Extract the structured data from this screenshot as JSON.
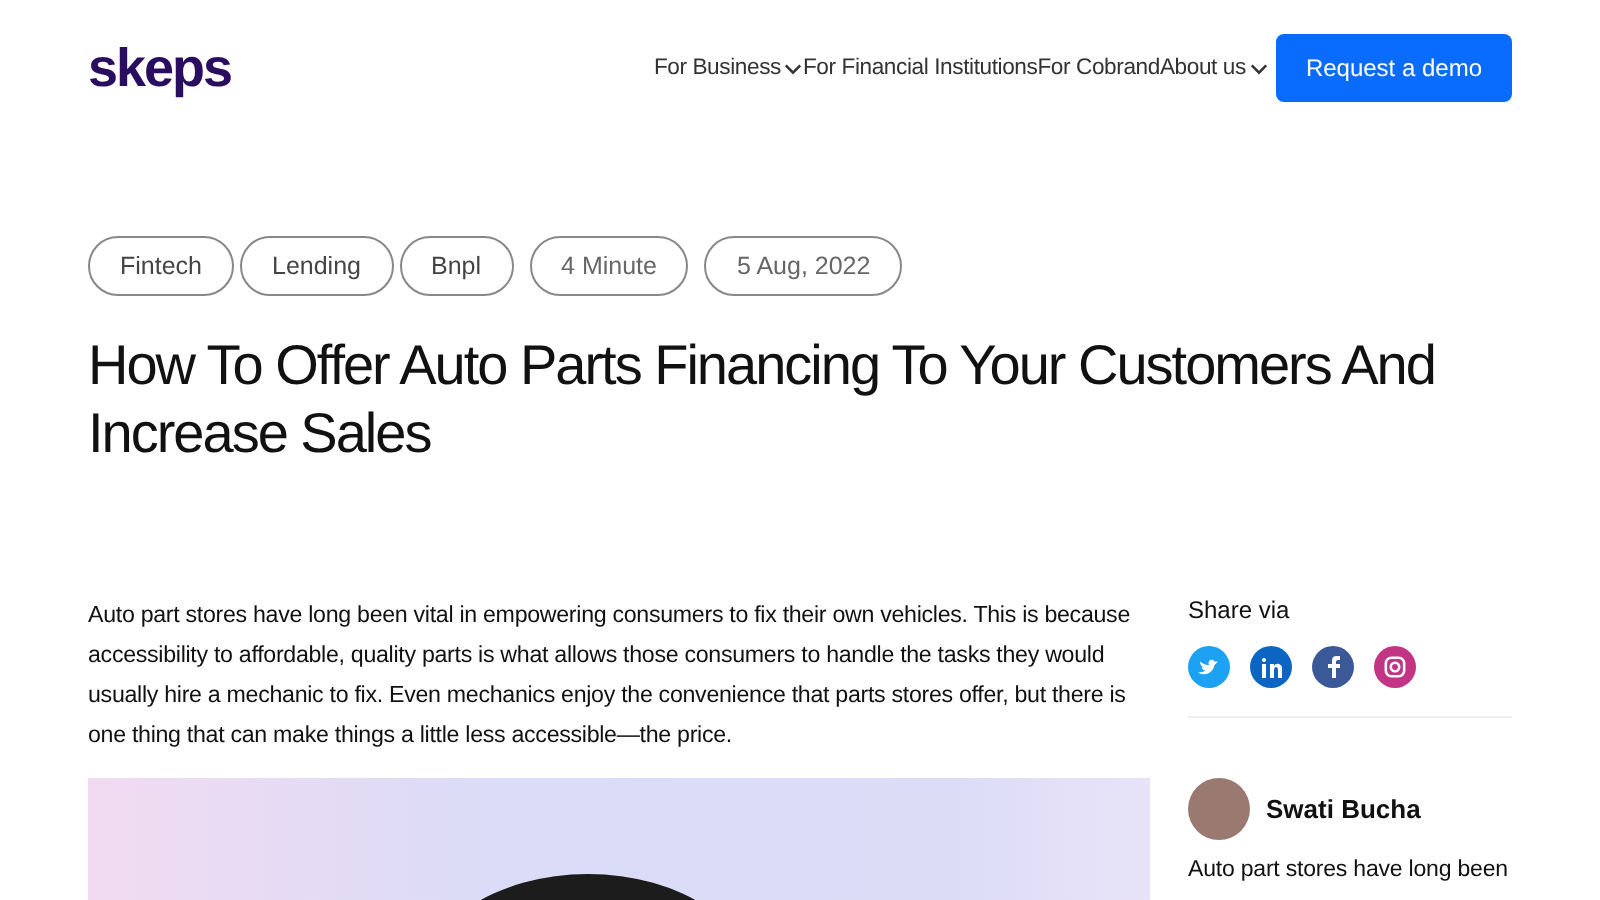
{
  "header": {
    "logo": "skeps",
    "nav": [
      {
        "label": "For Business",
        "dropdown": true
      },
      {
        "label": "For Financial Institutions",
        "dropdown": false
      },
      {
        "label": "For Cobrand",
        "dropdown": false
      },
      {
        "label": "About us",
        "dropdown": true
      }
    ],
    "cta": "Request a demo"
  },
  "tags": [
    {
      "label": "Fintech",
      "kind": "tag"
    },
    {
      "label": "Lending",
      "kind": "tag"
    },
    {
      "label": "Bnpl",
      "kind": "tag"
    },
    {
      "label": "4 Minute",
      "kind": "meta"
    },
    {
      "label": "5 Aug, 2022",
      "kind": "meta"
    }
  ],
  "title": "How To Offer Auto Parts Financing To Your Customers And Increase Sales",
  "body": "Auto part stores have long been vital in empowering consumers to fix their own vehicles. This is because accessibility to affordable, quality parts is what allows those consumers to handle the tasks they would usually hire a mechanic to fix. Even mechanics enjoy the convenience that parts stores offer, but there is one thing that can make things a little less accessible—the price.",
  "sidebar": {
    "share_label": "Share via",
    "share": [
      {
        "kind": "twitter",
        "color": "#1da1f2"
      },
      {
        "kind": "linkedin",
        "color": "#0a66c2"
      },
      {
        "kind": "facebook",
        "color": "#3b5998"
      },
      {
        "kind": "instagram",
        "color": "#c13584"
      }
    ],
    "author": "Swati Bucha",
    "author_bio": "Auto part stores have long been"
  }
}
